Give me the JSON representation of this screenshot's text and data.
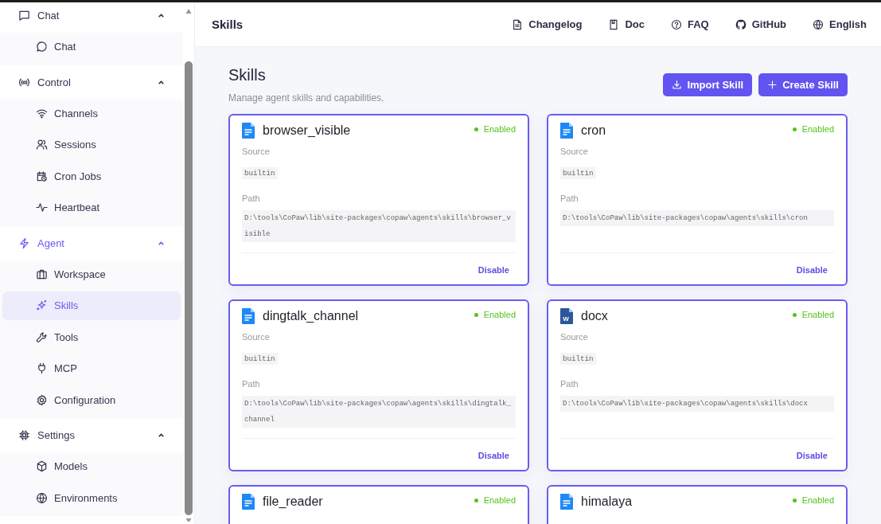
{
  "sidebar": {
    "groups": [
      {
        "label": "Chat",
        "expanded": true,
        "active": false,
        "children": [
          {
            "label": "Chat",
            "selected": false
          }
        ]
      },
      {
        "label": "Control",
        "expanded": true,
        "active": false,
        "children": [
          {
            "label": "Channels",
            "selected": false
          },
          {
            "label": "Sessions",
            "selected": false
          },
          {
            "label": "Cron Jobs",
            "selected": false
          },
          {
            "label": "Heartbeat",
            "selected": false
          }
        ]
      },
      {
        "label": "Agent",
        "expanded": true,
        "active": true,
        "children": [
          {
            "label": "Workspace",
            "selected": false
          },
          {
            "label": "Skills",
            "selected": true
          },
          {
            "label": "Tools",
            "selected": false
          },
          {
            "label": "MCP",
            "selected": false
          },
          {
            "label": "Configuration",
            "selected": false
          }
        ]
      },
      {
        "label": "Settings",
        "expanded": true,
        "active": false,
        "children": [
          {
            "label": "Models",
            "selected": false
          },
          {
            "label": "Environments",
            "selected": false
          }
        ]
      }
    ]
  },
  "header": {
    "title": "Skills",
    "links": [
      "Changelog",
      "Doc",
      "FAQ",
      "GitHub",
      "English"
    ]
  },
  "page": {
    "title": "Skills",
    "subtitle": "Manage agent skills and capabilities.",
    "buttons": [
      {
        "label": "Import Skill",
        "kind": "import"
      },
      {
        "label": "Create Skill",
        "kind": "create"
      }
    ]
  },
  "cards": [
    {
      "name": "browser_visible",
      "kind": "text",
      "status": "Enabled",
      "enabled": true,
      "source_label": "Source",
      "source": "builtin",
      "path_label": "Path",
      "path": "D:\\tools\\CoPaw\\lib\\site-packages\\copaw\\agents\\skills\\browser_visible",
      "action": "Disable"
    },
    {
      "name": "cron",
      "kind": "text",
      "status": "Enabled",
      "enabled": true,
      "source_label": "Source",
      "source": "builtin",
      "path_label": "Path",
      "path": "D:\\tools\\CoPaw\\lib\\site-packages\\copaw\\agents\\skills\\cron",
      "action": "Disable"
    },
    {
      "name": "dingtalk_channel",
      "kind": "text",
      "status": "Enabled",
      "enabled": true,
      "source_label": "Source",
      "source": "builtin",
      "path_label": "Path",
      "path": "D:\\tools\\CoPaw\\lib\\site-packages\\copaw\\agents\\skills\\dingtalk_channel",
      "action": "Disable"
    },
    {
      "name": "docx",
      "kind": "word",
      "icon_letter": "W",
      "status": "Enabled",
      "enabled": true,
      "source_label": "Source",
      "source": "builtin",
      "path_label": "Path",
      "path": "D:\\tools\\CoPaw\\lib\\site-packages\\copaw\\agents\\skills\\docx",
      "action": "Disable"
    },
    {
      "name": "file_reader",
      "kind": "text",
      "status": "Enabled",
      "enabled": true
    },
    {
      "name": "himalaya",
      "kind": "text",
      "status": "Enabled",
      "enabled": true
    }
  ]
}
